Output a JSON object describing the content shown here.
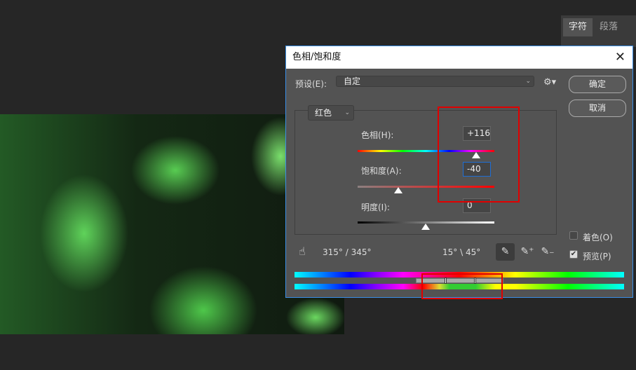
{
  "panel": {
    "tabs": [
      "字符",
      "段落"
    ]
  },
  "dialog": {
    "title": "色相/饱和度",
    "preset_label": "预设(E):",
    "preset_value": "自定",
    "ok": "确定",
    "cancel": "取消",
    "channel": "红色",
    "hue_label": "色相(H):",
    "hue_value": "+116",
    "sat_label": "饱和度(A):",
    "sat_value": "-40",
    "light_label": "明度(I):",
    "light_value": "0",
    "range_left": "315° / 345°",
    "range_right": "15° \\ 45°",
    "colorize": "着色(O)",
    "preview": "预览(P)",
    "slider_values": {
      "hue": 116,
      "saturation": -40,
      "lightness": 0
    },
    "preview_checked": true,
    "colorize_checked": false
  }
}
